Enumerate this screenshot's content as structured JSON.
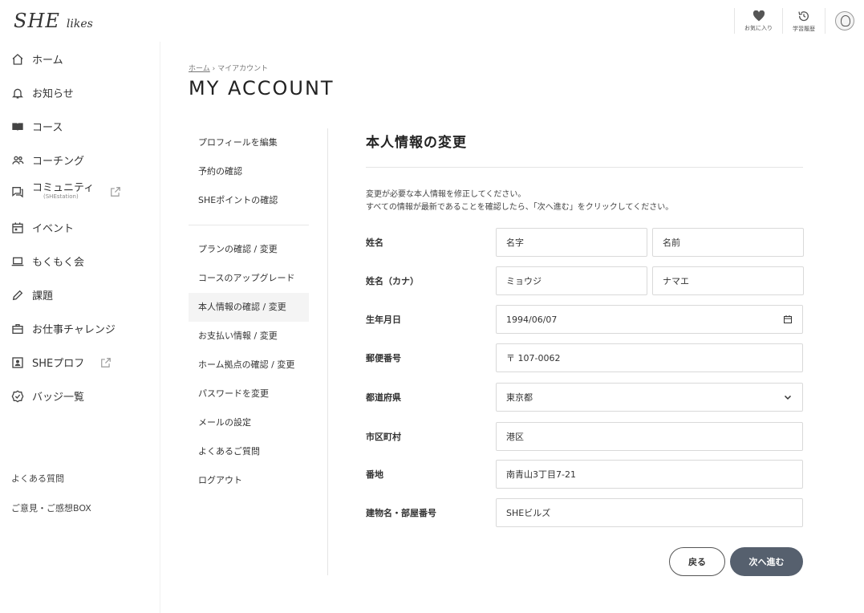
{
  "header": {
    "logo_main": "SHE",
    "logo_sub": "likes",
    "favorites_label": "お気に入り",
    "history_label": "学習履歴"
  },
  "sidebar": {
    "items": [
      {
        "label": "ホーム",
        "icon": "home-icon"
      },
      {
        "label": "お知らせ",
        "icon": "bell-icon"
      },
      {
        "label": "コース",
        "icon": "book-icon"
      },
      {
        "label": "コーチング",
        "icon": "people-icon"
      },
      {
        "label": "コミュニティ",
        "sub": "(SHEstation)",
        "icon": "chat-icon"
      },
      {
        "label": "イベント",
        "icon": "calendar-icon"
      },
      {
        "label": "もくもく会",
        "icon": "laptop-icon"
      },
      {
        "label": "課題",
        "icon": "pencil-icon"
      },
      {
        "label": "お仕事チャレンジ",
        "icon": "briefcase-icon"
      },
      {
        "label": "SHEプロフ",
        "icon": "profile-card-icon"
      },
      {
        "label": "バッジ一覧",
        "icon": "badge-icon"
      }
    ],
    "faq": "よくある質問",
    "feedback": "ご意見・ご感想BOX"
  },
  "breadcrumb": {
    "home": "ホーム",
    "separator": "›",
    "current": "マイアカウント"
  },
  "page_title": "MY ACCOUNT",
  "submenu": {
    "group1": [
      "プロフィールを編集",
      "予約の確認",
      "SHEポイントの確認"
    ],
    "group2": [
      "プランの確認 / 変更",
      "コースのアップグレード",
      "本人情報の確認 / 変更",
      "お支払い情報 / 変更",
      "ホーム拠点の確認 / 変更",
      "パスワードを変更",
      "メールの設定",
      "よくあるご質問",
      "ログアウト"
    ],
    "active": "本人情報の確認 / 変更"
  },
  "form": {
    "title": "本人情報の変更",
    "desc_line1": "変更が必要な本人情報を修正してください。",
    "desc_line2": "すべての情報が最新であることを確認したら、「次へ進む」をクリックしてください。",
    "name_label": "姓名",
    "last_name": "名字",
    "first_name": "名前",
    "kana_label": "姓名（カナ）",
    "last_kana": "ミョウジ",
    "first_kana": "ナマエ",
    "birthday_label": "生年月日",
    "birthday": "1994/06/07",
    "postal_label": "郵便番号",
    "postal": "〒 107-0062",
    "prefecture_label": "都道府県",
    "prefecture": "東京都",
    "city_label": "市区町村",
    "city": "港区",
    "address_label": "番地",
    "address": "南青山3丁目7-21",
    "building_label": "建物名・部屋番号",
    "building": "SHEビルズ",
    "back_button": "戻る",
    "next_button": "次へ進む"
  }
}
